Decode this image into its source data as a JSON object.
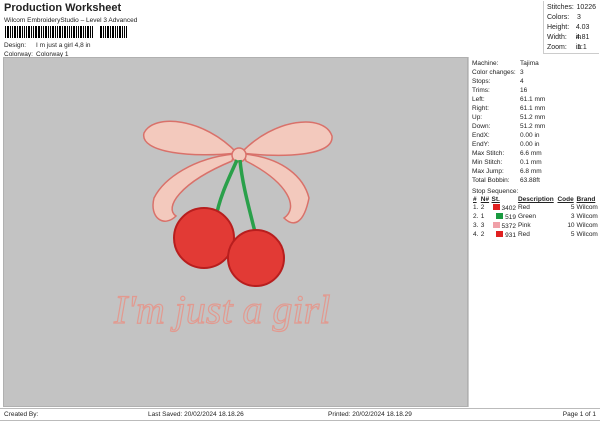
{
  "header": {
    "title": "Production Worksheet",
    "subtitle": "Wilcom EmbroideryStudio – Level 3 Advanced",
    "design_label": "Design:",
    "design_value": "I m just a girl 4,8 in",
    "colorway_label": "Colorway:",
    "colorway_value": "Colorway 1"
  },
  "stats": [
    {
      "label": "Stitches:",
      "value": "10226"
    },
    {
      "label": "Colors:",
      "value": "3"
    },
    {
      "label": "Height:",
      "value": "4.03 in"
    },
    {
      "label": "Width:",
      "value": "4.81 in"
    },
    {
      "label": "Zoom:",
      "value": "1:1"
    }
  ],
  "details": [
    {
      "label": "Machine:",
      "value": "Tajima"
    },
    {
      "label": "Color changes:",
      "value": "3"
    },
    {
      "label": "Stops:",
      "value": "4"
    },
    {
      "label": "Trims:",
      "value": "16"
    },
    {
      "label": "Left:",
      "value": "61.1 mm"
    },
    {
      "label": "Right:",
      "value": "61.1 mm"
    },
    {
      "label": "Up:",
      "value": "51.2 mm"
    },
    {
      "label": "Down:",
      "value": "51.2 mm"
    },
    {
      "label": "EndX:",
      "value": "0.00 in"
    },
    {
      "label": "EndY:",
      "value": "0.00 in"
    },
    {
      "label": "Max Stitch:",
      "value": "6.6 mm"
    },
    {
      "label": "Min Stitch:",
      "value": "0.1 mm"
    },
    {
      "label": "Max Jump:",
      "value": "6.8 mm"
    },
    {
      "label": "Total Bobbin:",
      "value": "63.88ft"
    }
  ],
  "stop_sequence": {
    "title": "Stop Sequence:",
    "headers": [
      "#",
      "N#",
      "St.",
      "Description",
      "Code",
      "Brand"
    ],
    "rows": [
      {
        "idx": "1.",
        "n": "2",
        "color": "#e02020",
        "st": "3402",
        "desc": "Red",
        "code": "5",
        "brand": "Wilcom"
      },
      {
        "idx": "2.",
        "n": "1",
        "color": "#1a9a40",
        "st": "519",
        "desc": "Green",
        "code": "3",
        "brand": "Wilcom"
      },
      {
        "idx": "3.",
        "n": "3",
        "color": "#f0a0a8",
        "st": "5372",
        "desc": "Pink",
        "code": "10",
        "brand": "Wilcom"
      },
      {
        "idx": "4.",
        "n": "2",
        "color": "#e02020",
        "st": "931",
        "desc": "Red",
        "code": "5",
        "brand": "Wilcom"
      }
    ]
  },
  "design_text": "I'm just a girl",
  "footer": {
    "created": "Created By:",
    "saved": "Last Saved: 20/02/2024 18.18.26",
    "printed": "Printed: 20/02/2024 18.18.29",
    "page": "Page 1 of 1"
  }
}
